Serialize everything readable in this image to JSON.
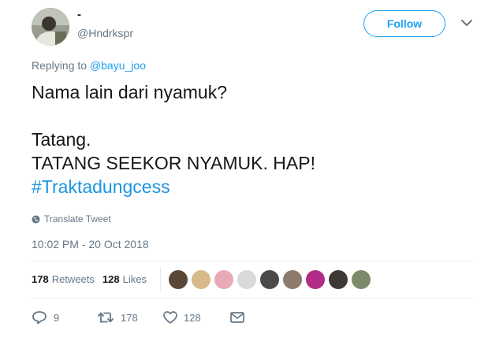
{
  "tweet": {
    "display_name": "-",
    "handle": "@Hndrkspr",
    "follow_label": "Follow",
    "replying_prefix": "Replying to",
    "replying_to": "@bayu_joo",
    "text_lines": [
      "Nama lain dari nyamuk?",
      "",
      "Tatang.",
      "TATANG SEEKOR NYAMUK. HAP!"
    ],
    "hashtag": "#Traktadungcess",
    "translate_label": "Translate Tweet",
    "timestamp": "10:02 PM - 20 Oct 2018"
  },
  "stats": {
    "retweets_count": "178",
    "retweets_label": "Retweets",
    "likes_count": "128",
    "likes_label": "Likes"
  },
  "likers": [
    {
      "color": "#5a4636"
    },
    {
      "color": "#d8b98a"
    },
    {
      "color": "#e8a9b8"
    },
    {
      "color": "#d9d9d9"
    },
    {
      "color": "#4a4a4a"
    },
    {
      "color": "#8c7b6b"
    },
    {
      "color": "#b02c86"
    },
    {
      "color": "#3d3a35"
    },
    {
      "color": "#7a8a6a"
    }
  ],
  "actions": {
    "reply_count": "9",
    "retweet_count": "178",
    "like_count": "128"
  },
  "icons": {
    "reply": "reply-icon",
    "retweet": "retweet-icon",
    "like": "heart-icon",
    "message": "envelope-icon",
    "translate": "globe-icon",
    "caret": "chevron-down-icon"
  },
  "colors": {
    "accent": "#1da1f2",
    "hashtag": "#1b95e0",
    "muted": "#657786",
    "text": "#14171a"
  }
}
